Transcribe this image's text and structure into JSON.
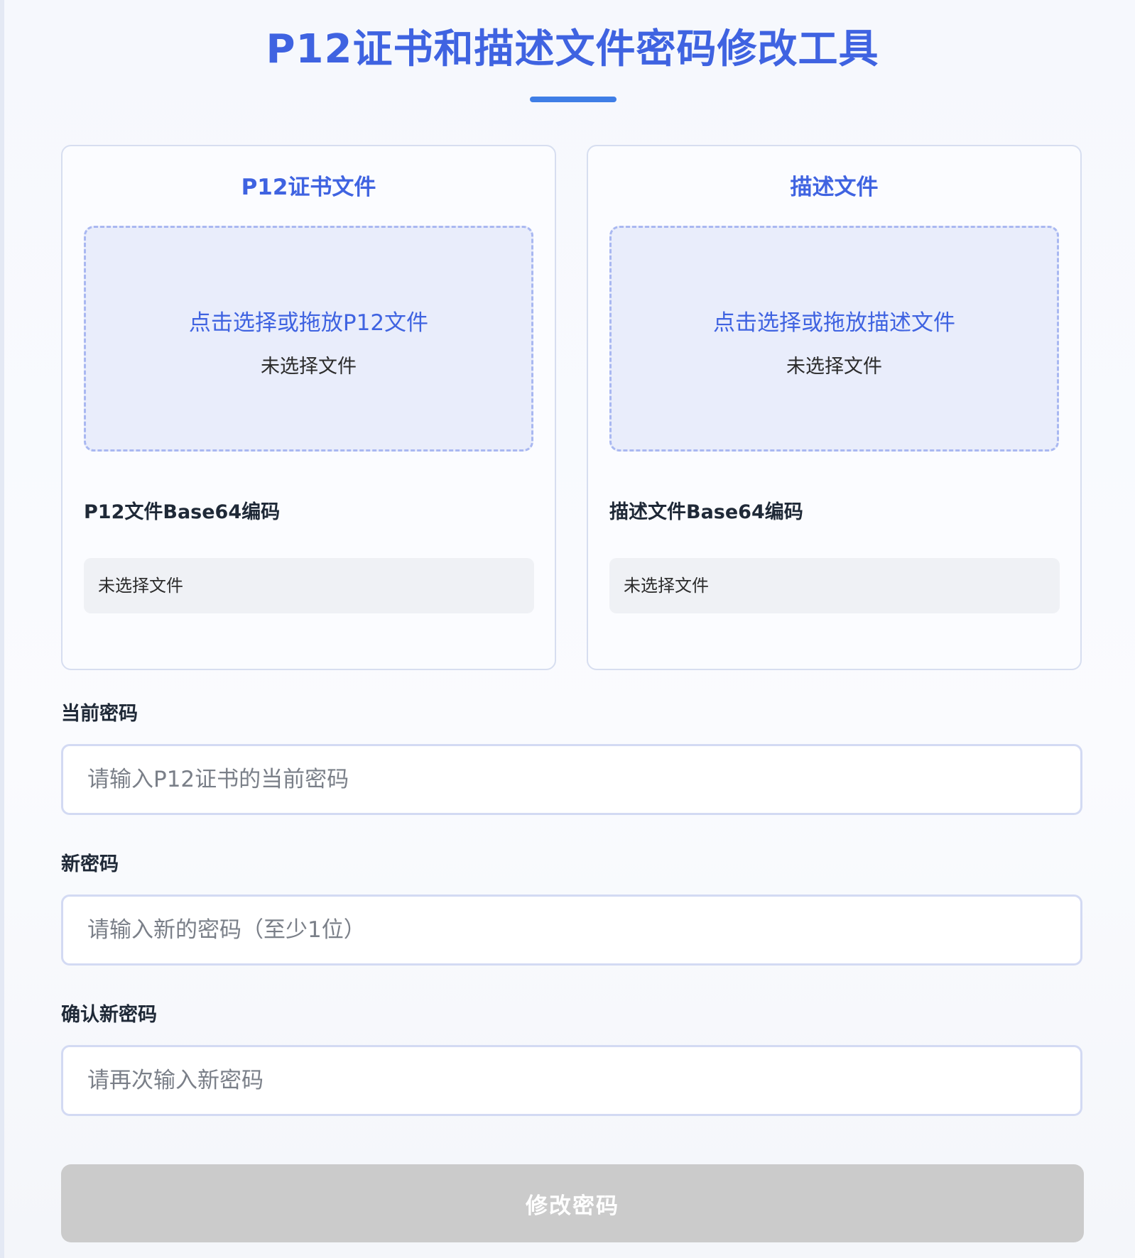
{
  "header": {
    "title": "P12证书和描述文件密码修改工具"
  },
  "p12_card": {
    "title": "P12证书文件",
    "drop_prompt": "点击选择或拖放P12文件",
    "drop_status": "未选择文件",
    "base64_label": "P12文件Base64编码",
    "base64_value": "未选择文件"
  },
  "profile_card": {
    "title": "描述文件",
    "drop_prompt": "点击选择或拖放描述文件",
    "drop_status": "未选择文件",
    "base64_label": "描述文件Base64编码",
    "base64_value": "未选择文件"
  },
  "form": {
    "current_password_label": "当前密码",
    "current_password_placeholder": "请输入P12证书的当前密码",
    "current_password_value": "",
    "new_password_label": "新密码",
    "new_password_placeholder": "请输入新的密码（至少1位）",
    "new_password_value": "",
    "confirm_password_label": "确认新密码",
    "confirm_password_placeholder": "请再次输入新密码",
    "confirm_password_value": "",
    "submit_label": "修改密码"
  },
  "colors": {
    "accent": "#3f63e1",
    "underline": "#3f7ee6",
    "drop_zone_bg": "#e9edfb",
    "drop_zone_border": "#a9b8f1",
    "button_disabled": "#cbcbcb"
  }
}
